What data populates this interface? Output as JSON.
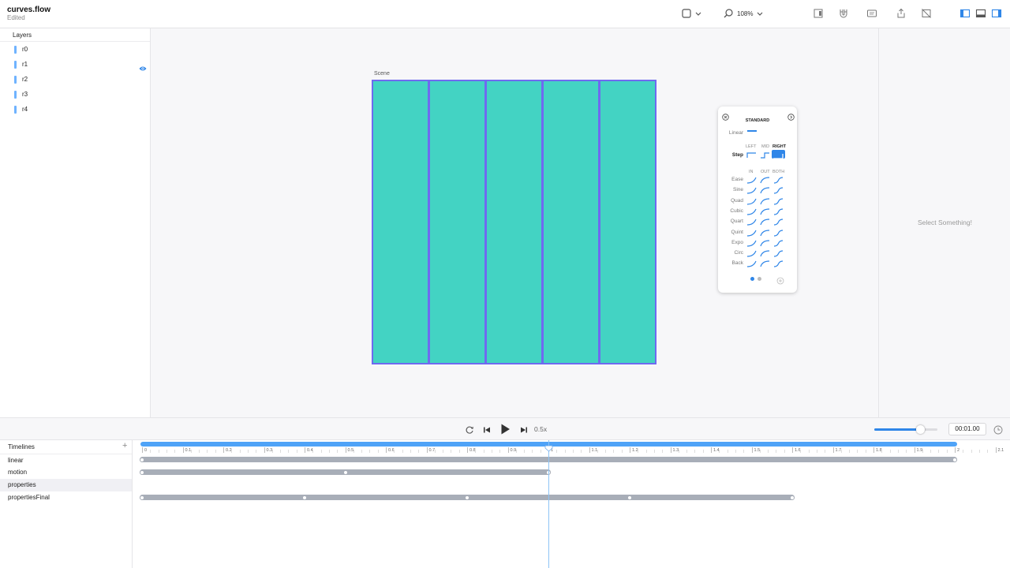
{
  "document": {
    "title": "curves.flow",
    "status": "Edited"
  },
  "toolbar": {
    "zoom": "108%"
  },
  "layers": {
    "title": "Layers",
    "items": [
      {
        "label": "r0"
      },
      {
        "label": "r1"
      },
      {
        "label": "r2"
      },
      {
        "label": "r3"
      },
      {
        "label": "r4"
      }
    ]
  },
  "scene": {
    "label": "Scene",
    "fill_color": "#43d3c3",
    "border_color": "#6f6af0"
  },
  "inspector": {
    "empty_text": "Select Something!"
  },
  "easing": {
    "heading": "STANDARD",
    "linear_label": "Linear",
    "step_label": "Step",
    "step_options": [
      "LEFT",
      "MID",
      "RIGHT"
    ],
    "columns": [
      "IN",
      "OUT",
      "BOTH"
    ],
    "rows": [
      "Ease",
      "Sine",
      "Quad",
      "Cubic",
      "Quart",
      "Quint",
      "Expo",
      "Circ",
      "Back"
    ]
  },
  "transport": {
    "speed": "0.5x",
    "time": "00:01.00",
    "volume_fraction": 0.72
  },
  "timelines": {
    "title": "Timelines",
    "add_label": "+",
    "items": [
      {
        "label": "linear"
      },
      {
        "label": "motion"
      },
      {
        "label": "properties"
      },
      {
        "label": "propertiesFinal"
      }
    ]
  },
  "ruler": {
    "labels": [
      "0",
      "0.1",
      "0.2",
      "0.3",
      "0.4",
      "0.5",
      "0.6",
      "0.7",
      "0.8",
      "0.9",
      "1",
      "1.1",
      "1.2",
      "1.3",
      "1.4",
      "1.5",
      "1.6",
      "1.7",
      "1.8",
      "1.9",
      "2",
      "2.1"
    ],
    "playhead_time": 1.0,
    "duration": 2.0
  },
  "tracks": [
    {
      "start": 0,
      "end": 2.0,
      "keyframes": [
        0,
        2.0
      ]
    },
    {
      "start": 0,
      "end": 1.0,
      "keyframes": [
        0,
        0.5,
        1.0
      ]
    },
    {
      "start": 0,
      "end": 0,
      "keyframes": []
    },
    {
      "start": 0,
      "end": 1.6,
      "keyframes": [
        0,
        0.4,
        0.8,
        1.2,
        1.6
      ]
    }
  ],
  "colors": {
    "accent": "#2f86e8",
    "track": "#a8aeb8"
  }
}
